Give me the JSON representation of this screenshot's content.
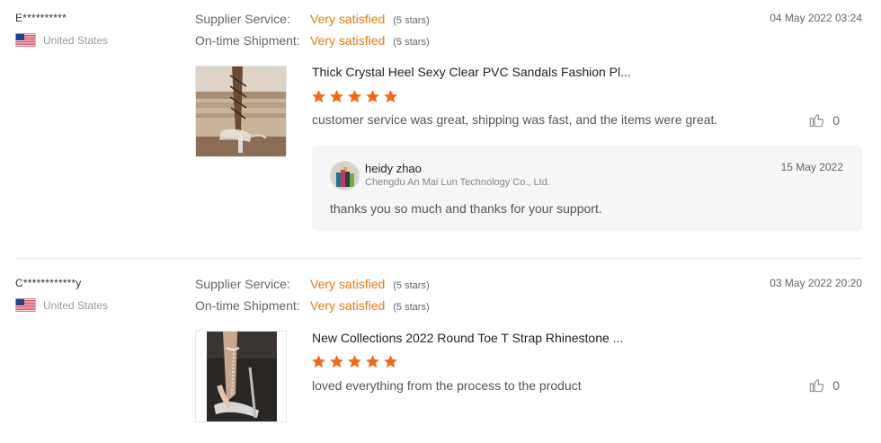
{
  "reviews": [
    {
      "buyer": "E**********",
      "country": "United States",
      "flag_icon": "us-flag-icon",
      "date": "04 May 2022 03:24",
      "ratings": [
        {
          "label": "Supplier Service:",
          "value": "Very satisfied",
          "stars": "(5 stars)"
        },
        {
          "label": "On-time Shipment:",
          "value": "Very satisfied",
          "stars": "(5 stars)"
        }
      ],
      "product_title": "Thick Crystal Heel Sexy Clear PVC Sandals Fashion Pl...",
      "star_rating": 5,
      "comment": "customer service was great, shipping was fast, and the items were great.",
      "likes": "0",
      "reply": {
        "name": "heidy zhao",
        "company": "Chengdu An Mai Lun Technology Co., Ltd.",
        "date": "15 May 2022",
        "text": "thanks you so much and thanks for your support."
      }
    },
    {
      "buyer": "C************y",
      "country": "United States",
      "flag_icon": "us-flag-icon",
      "date": "03 May 2022 20:20",
      "ratings": [
        {
          "label": "Supplier Service:",
          "value": "Very satisfied",
          "stars": "(5 stars)"
        },
        {
          "label": "On-time Shipment:",
          "value": "Very satisfied",
          "stars": "(5 stars)"
        }
      ],
      "product_title": "New Collections 2022 Round Toe T Strap Rhinestone ...",
      "star_rating": 5,
      "comment": "loved everything from the process to the product",
      "likes": "0"
    }
  ],
  "colors": {
    "accent": "#e87a16",
    "star": "#f06a1a",
    "divider": "#e5e5e5",
    "reply_bg": "#f6f6f6"
  }
}
